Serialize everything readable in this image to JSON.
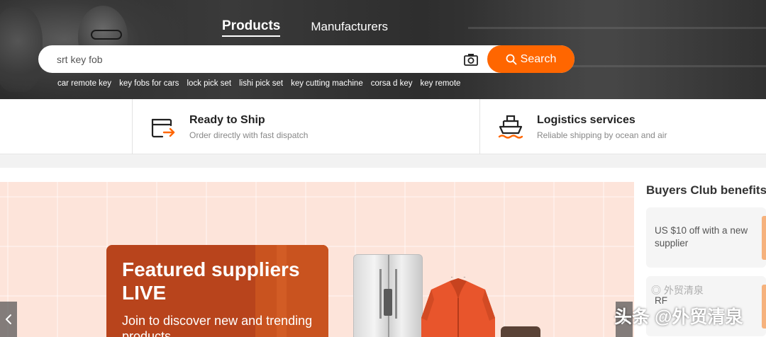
{
  "header": {
    "tabs": [
      {
        "label": "Products",
        "active": true
      },
      {
        "label": "Manufacturers",
        "active": false
      }
    ],
    "search": {
      "value": "srt key fob",
      "button_label": "Search"
    },
    "suggestions": [
      "car remote key",
      "key fobs for cars",
      "lock pick set",
      "lishi pick set",
      "key cutting machine",
      "corsa d key",
      "key remote"
    ]
  },
  "services": [
    {
      "title": "Ready to Ship",
      "subtitle": "Order directly with fast dispatch",
      "icon": "package-arrow-icon"
    },
    {
      "title": "Logistics services",
      "subtitle": "Reliable shipping by ocean and air",
      "icon": "ship-icon"
    }
  ],
  "banner": {
    "title": "Featured suppliers LIVE",
    "subtitle": "Join to discover new and trending products"
  },
  "buyers_club": {
    "title": "Buyers Club benefits",
    "cards": [
      {
        "text": "US $10 off with a new supplier"
      },
      {
        "text": "RF"
      }
    ]
  },
  "watermark": {
    "text": "头条 @外贸清泉",
    "wechat_text": "外贸清泉"
  },
  "colors": {
    "accent": "#ff6600",
    "banner_bg": "#fde4da",
    "banner_card": "#b8441c"
  }
}
